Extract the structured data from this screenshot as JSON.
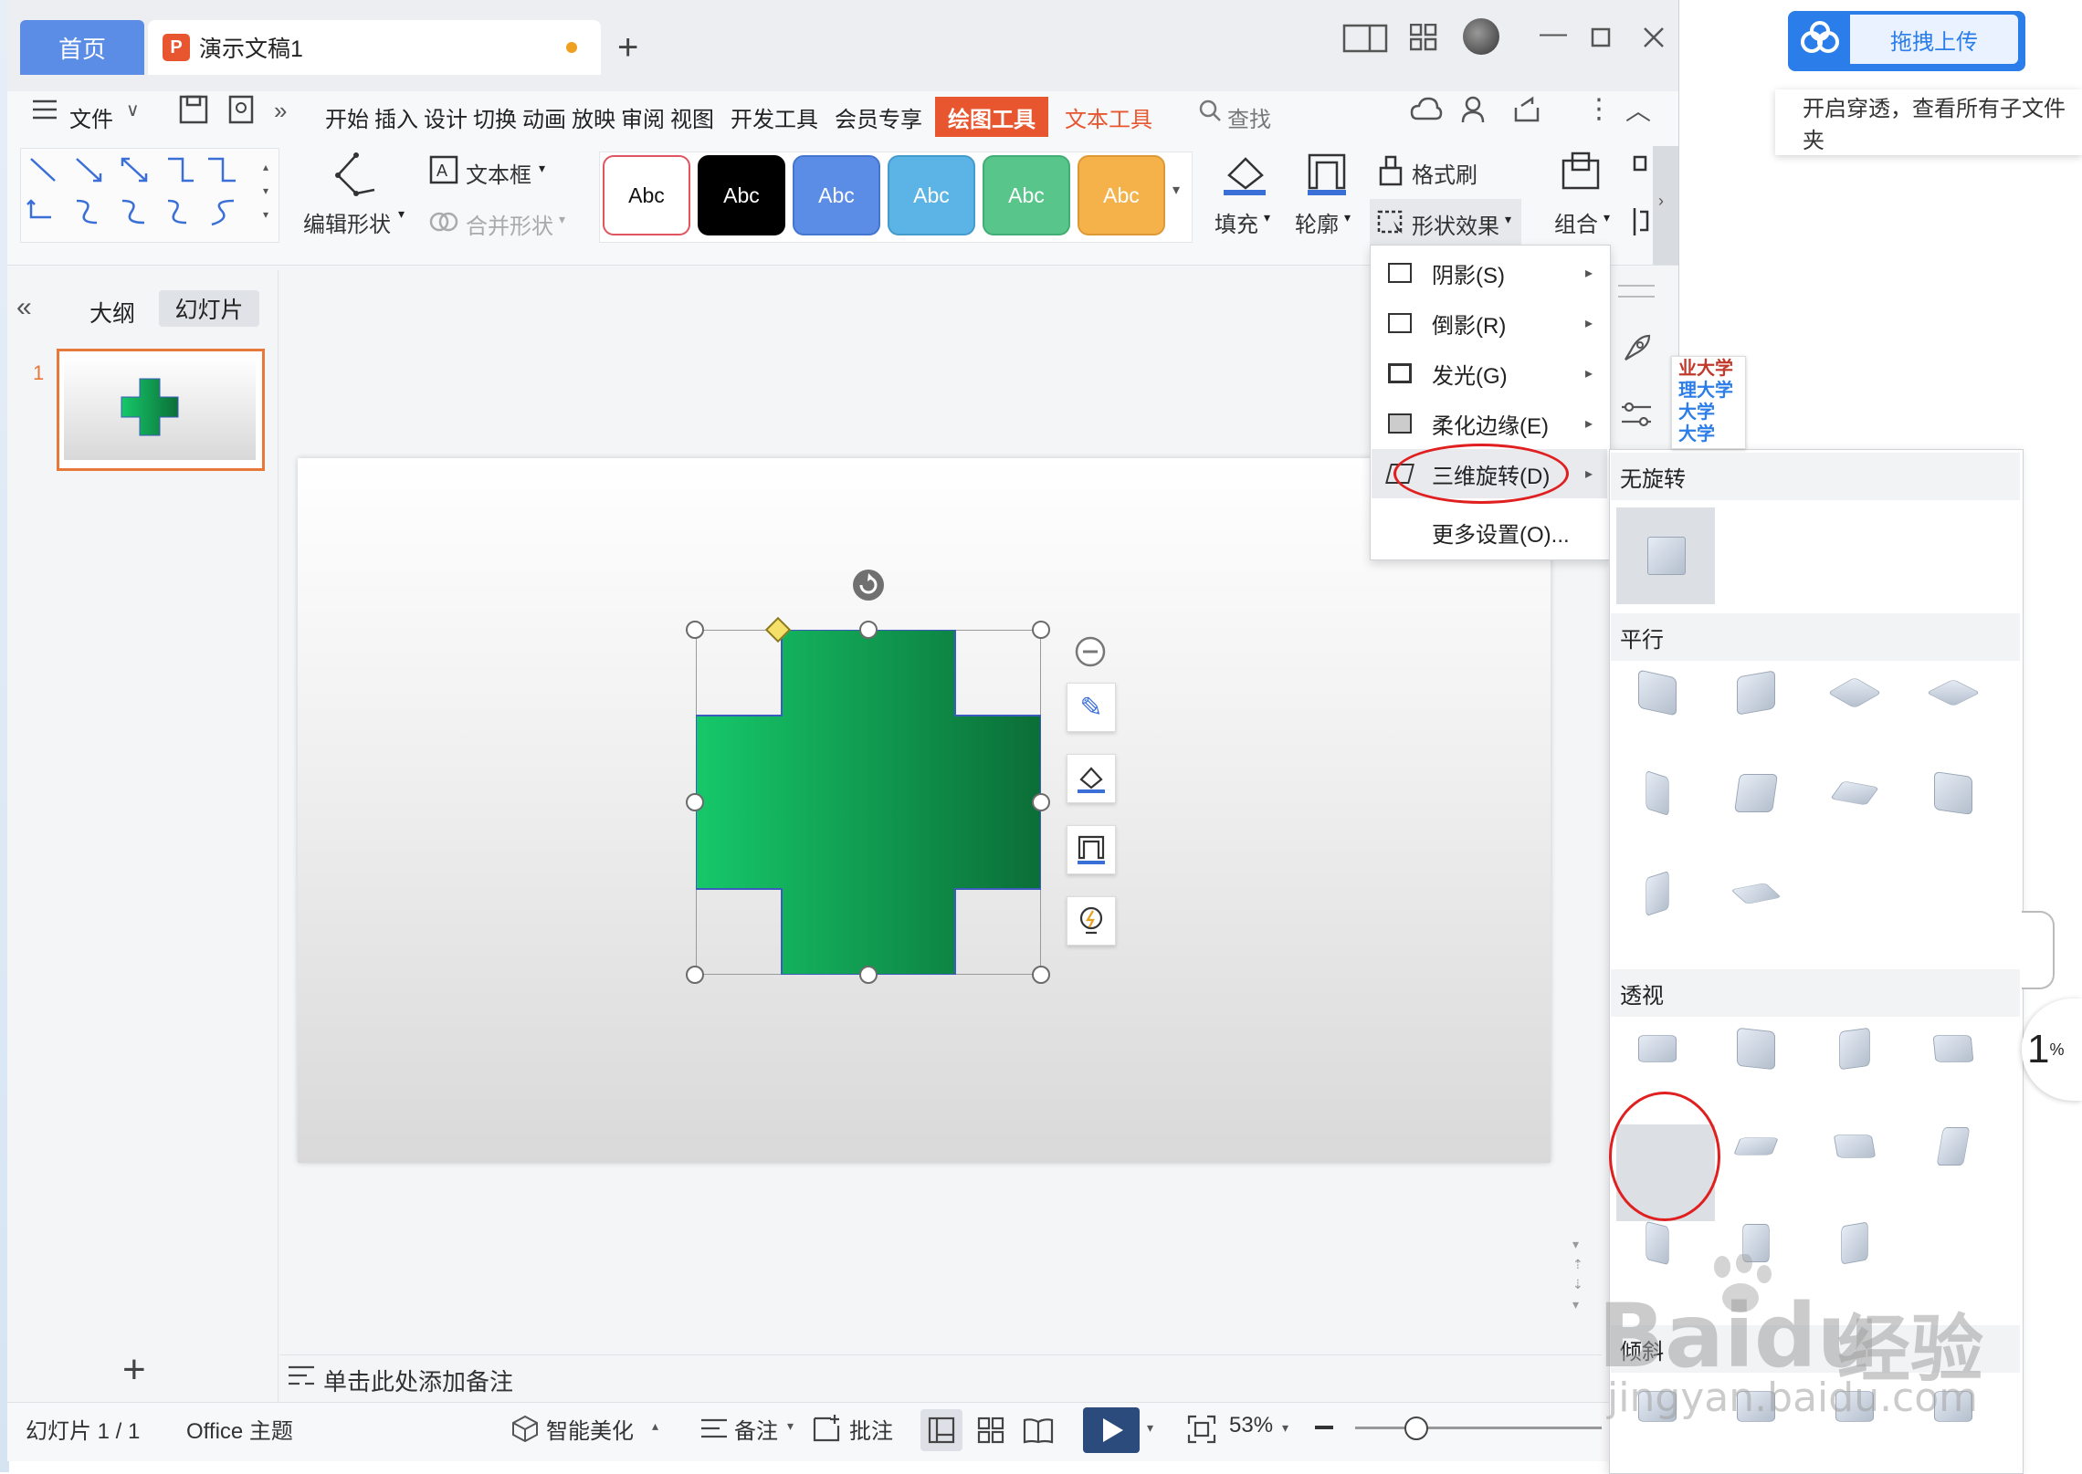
{
  "titlebar": {
    "home_tab": "首页",
    "doc_tab": "演示文稿1",
    "ppt_logo": "P"
  },
  "ribbon_tabs": {
    "file": "文件",
    "items": [
      "开始",
      "插入",
      "设计",
      "切换",
      "动画",
      "放映",
      "审阅",
      "视图",
      "开发工具",
      "会员专享"
    ],
    "drawing_tools": "绘图工具",
    "text_tools": "文本工具",
    "search": "查找"
  },
  "ribbon": {
    "edit_shape": "编辑形状",
    "textbox": "文本框",
    "merge_shape": "合并形状",
    "style_samples": [
      {
        "label": "Abc",
        "bg": "#ffffff",
        "fg": "#111111",
        "border": "#e0555f"
      },
      {
        "label": "Abc",
        "bg": "#000000",
        "fg": "#ffffff",
        "border": "#000000"
      },
      {
        "label": "Abc",
        "bg": "#5b8de6",
        "fg": "#ffffff",
        "border": "#4476cf"
      },
      {
        "label": "Abc",
        "bg": "#5bb4e5",
        "fg": "#ffffff",
        "border": "#449ccc"
      },
      {
        "label": "Abc",
        "bg": "#58c58b",
        "fg": "#ffffff",
        "border": "#42ad74"
      },
      {
        "label": "Abc",
        "bg": "#f6b24a",
        "fg": "#ffffff",
        "border": "#dd9a34"
      }
    ],
    "fill": "填充",
    "outline": "轮廓",
    "format_painter": "格式刷",
    "shape_effects": "形状效果",
    "group": "组合"
  },
  "left_panel": {
    "outline_tab": "大纲",
    "slides_tab": "幻灯片",
    "slide_number": "1"
  },
  "effects_menu": {
    "items": [
      {
        "label": "阴影(S)"
      },
      {
        "label": "倒影(R)"
      },
      {
        "label": "发光(G)"
      },
      {
        "label": "柔化边缘(E)"
      },
      {
        "label": "三维旋转(D)"
      }
    ],
    "more": "更多设置(O)..."
  },
  "rotation_gallery": {
    "no_rotation": "无旋转",
    "parallel": "平行",
    "perspective": "透视",
    "oblique": "倾斜"
  },
  "notes": {
    "placeholder": "单击此处添加备注"
  },
  "statusbar": {
    "slide_info": "幻灯片 1 / 1",
    "theme": "Office 主题",
    "beautify": "智能美化",
    "notes": "备注",
    "comments": "批注",
    "zoom": "53%"
  },
  "desktop": {
    "upload_button": "拖拽上传",
    "tip": "开启穿透，查看所有子文件夹",
    "percent_digit": "1",
    "percent_sign": "%",
    "side_labels": [
      "业大学",
      "理大学",
      "大学",
      "大学"
    ]
  },
  "watermark": {
    "brand": "Baidu",
    "cn": "经验",
    "url": "jingyan.baidu.com"
  },
  "colors": {
    "accent": "#e8562f",
    "tab_blue": "#5b8de6",
    "shape_green_start": "#16c86a",
    "shape_green_end": "#0b6e37",
    "upload_blue": "#2b7de9",
    "annotation_red": "#e02020"
  }
}
